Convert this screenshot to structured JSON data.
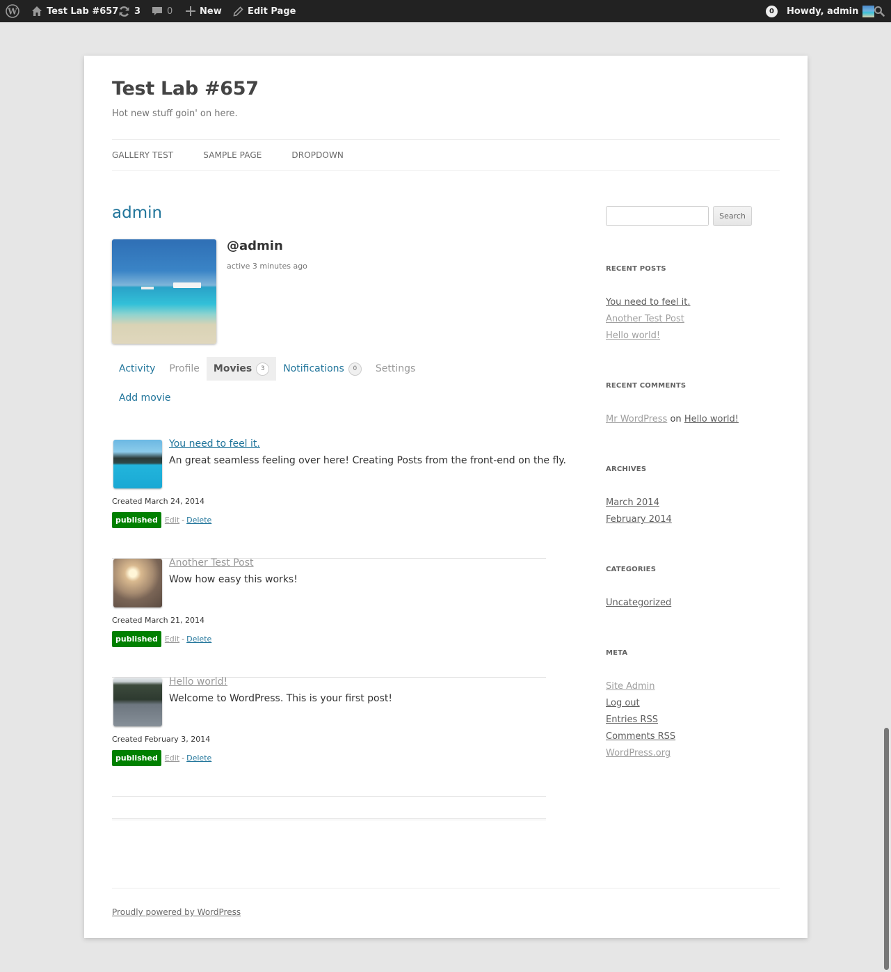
{
  "adminbar": {
    "wp_logo_icon": "wordpress-logo-icon",
    "site_name": "Test Lab #657",
    "updates_count": "3",
    "comments_count": "0",
    "new_label": "New",
    "edit_page_label": "Edit Page",
    "notifications_count": "0",
    "howdy_label": "Howdy, admin"
  },
  "site": {
    "title": "Test Lab #657",
    "description": "Hot new stuff goin' on here."
  },
  "nav": {
    "items": [
      {
        "label": "GALLERY TEST"
      },
      {
        "label": "SAMPLE PAGE"
      },
      {
        "label": "DROPDOWN"
      }
    ]
  },
  "profile": {
    "name": "admin",
    "handle": "@admin",
    "last_active": "active 3 minutes ago"
  },
  "tabs": [
    {
      "label": "Activity"
    },
    {
      "label": "Profile"
    },
    {
      "label": "Movies",
      "count": "3",
      "active": true
    },
    {
      "label": "Notifications",
      "count": "0"
    },
    {
      "label": "Settings"
    }
  ],
  "subnav": {
    "add_label": "Add movie"
  },
  "movies": [
    {
      "title": "You need to feel it.",
      "excerpt": "An great seamless feeling over here! Creating Posts from the front-end on the fly.",
      "created": "Created March 24, 2014",
      "status": "published",
      "edit_label": "Edit",
      "separator": "-",
      "delete_label": "Delete"
    },
    {
      "title": "Another Test Post",
      "excerpt": "Wow how easy this works!",
      "created": "Created March 21, 2014",
      "status": "published",
      "edit_label": "Edit",
      "separator": "-",
      "delete_label": "Delete"
    },
    {
      "title": "Hello world!",
      "excerpt": "Welcome to WordPress. This is your first post!",
      "created": "Created February 3, 2014",
      "status": "published",
      "edit_label": "Edit",
      "separator": "-",
      "delete_label": "Delete"
    }
  ],
  "sidebar": {
    "search": {
      "value": "",
      "button_label": "Search"
    },
    "recent_posts": {
      "title": "RECENT POSTS",
      "items": [
        "You need to feel it.",
        "Another Test Post",
        "Hello world!"
      ]
    },
    "recent_comments": {
      "title": "RECENT COMMENTS",
      "author": "Mr WordPress",
      "on": "on",
      "post": "Hello world!"
    },
    "archives": {
      "title": "ARCHIVES",
      "items": [
        "March 2014",
        "February 2014"
      ]
    },
    "categories": {
      "title": "CATEGORIES",
      "items": [
        "Uncategorized"
      ]
    },
    "meta": {
      "title": "META",
      "items": [
        "Site Admin",
        "Log out",
        "Entries RSS",
        "Comments RSS",
        "WordPress.org"
      ]
    }
  },
  "footer": {
    "credit": "Proudly powered by WordPress"
  },
  "colors": {
    "link_blue": "#21759b",
    "published_green": "#008000",
    "adminbar_bg": "#222222",
    "page_bg": "#e6e6e6"
  }
}
